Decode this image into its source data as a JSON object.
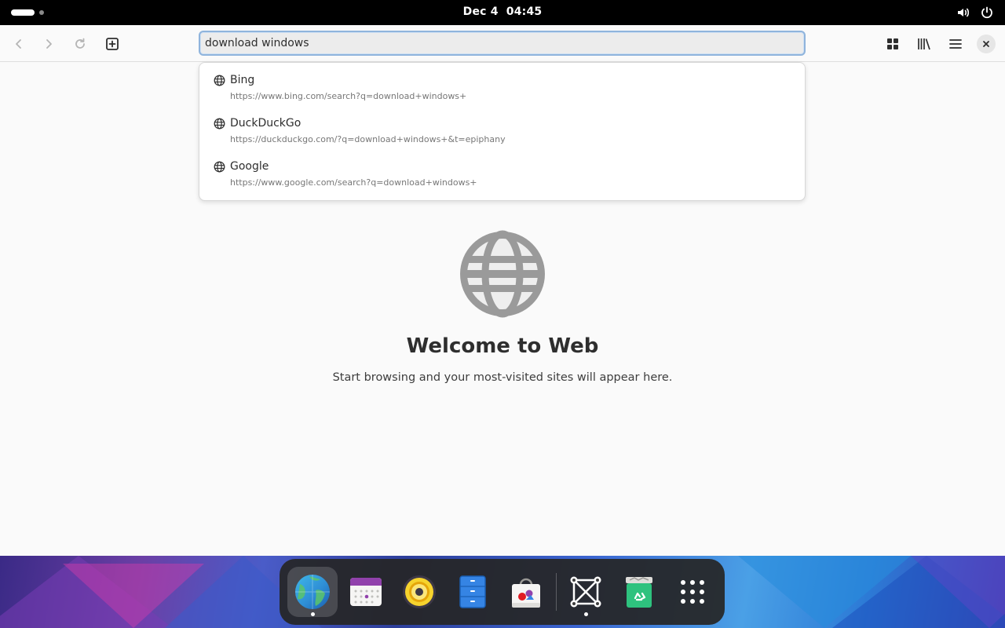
{
  "topbar": {
    "clock": "Dec 4  04:45"
  },
  "urlbar": {
    "value": "download windows "
  },
  "suggestions": [
    {
      "title": "Bing",
      "url": "https://www.bing.com/search?q=download+windows+"
    },
    {
      "title": "DuckDuckGo",
      "url": "https://duckduckgo.com/?q=download+windows+&t=epiphany"
    },
    {
      "title": "Google",
      "url": "https://www.google.com/search?q=download+windows+"
    }
  ],
  "welcome": {
    "title": "Welcome to Web",
    "subtitle": "Start browsing and your most-visited sites will appear here."
  },
  "dock": {
    "apps": [
      "web-browser",
      "calendar",
      "rhythmbox",
      "files",
      "software",
      "screenshot-tool",
      "trash",
      "show-apps"
    ]
  },
  "colors": {
    "accent": "#3584e4",
    "focus_ring": "#8fb4dc"
  }
}
